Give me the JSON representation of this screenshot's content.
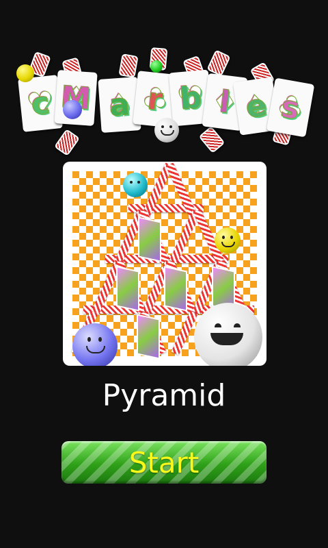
{
  "logo": {
    "letters": [
      "c",
      "M",
      "a",
      "r",
      "b",
      "l",
      "e",
      "s"
    ],
    "letter_colors": [
      "#4fbf6a",
      "#d35bb0",
      "#3fae55",
      "#d55",
      "#43b26a",
      "#c85fb5",
      "#4fb36a",
      "#d66bb8"
    ]
  },
  "level": {
    "name": "Pyramid",
    "image_icon": "pyramid-level-icon"
  },
  "start": {
    "label": "Start"
  },
  "colors": {
    "background": "#0f0f0f",
    "start_button": "#36b31f",
    "start_text": "#f8f81a",
    "checker_orange": "#f7a21f"
  }
}
